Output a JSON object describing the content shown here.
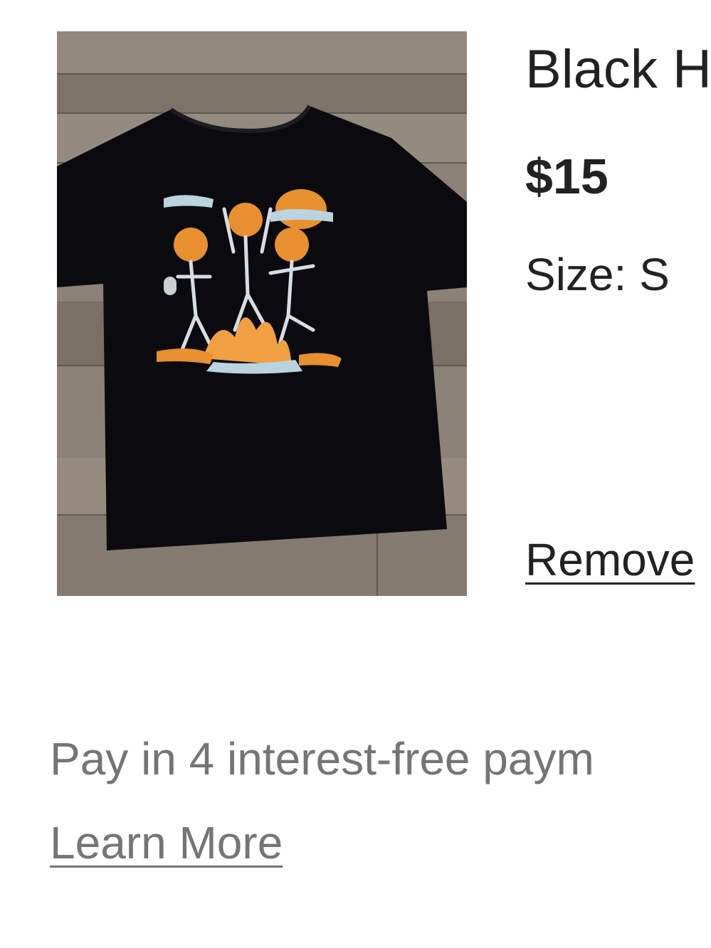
{
  "cart_item": {
    "image_icon": "product-photo",
    "title": "Black H",
    "price": "$15",
    "size": "Size: S",
    "remove_label": "Remove"
  },
  "payment": {
    "installments_text": "Pay in 4 interest-free paym",
    "learn_more_label": "Learn More"
  },
  "colors": {
    "text_primary": "#222222",
    "text_secondary": "#757575",
    "shirt": "#0b0b0f",
    "print_orange": "#e8902f",
    "floor": "#8a7f74"
  }
}
